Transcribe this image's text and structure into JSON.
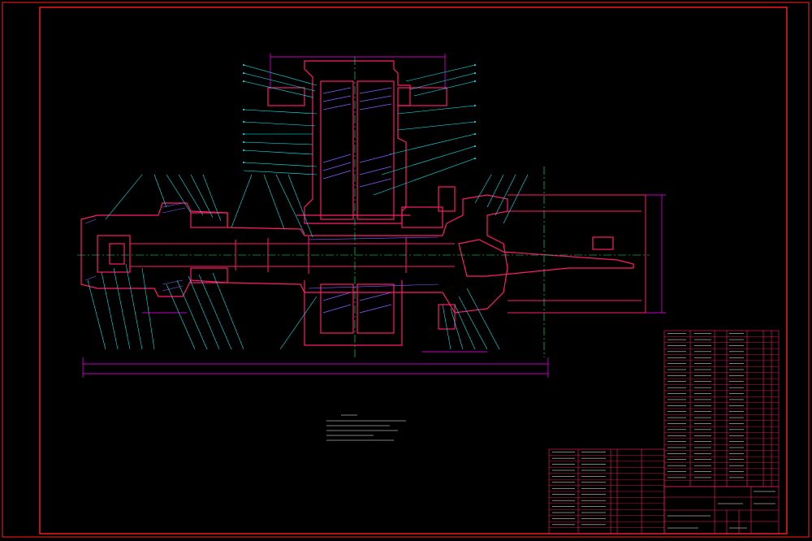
{
  "colors": {
    "background": "#000000",
    "border": "#ff2020",
    "part_outline": "#ff1c6b",
    "dimension": "#ff00ff",
    "leader": "#00ffff",
    "centerline": "#00ff66",
    "hatch": "#8a5cff",
    "text": "#ffffff",
    "accent": "#ffff00"
  },
  "drawing": {
    "notes": {
      "title": "",
      "lines": []
    },
    "dimension_text": {
      "overall_length": "",
      "right_height": ""
    }
  },
  "parts_list": {
    "rows": 26
  },
  "title_block": {
    "drawing_name": "",
    "scale": "",
    "sheet": ""
  }
}
